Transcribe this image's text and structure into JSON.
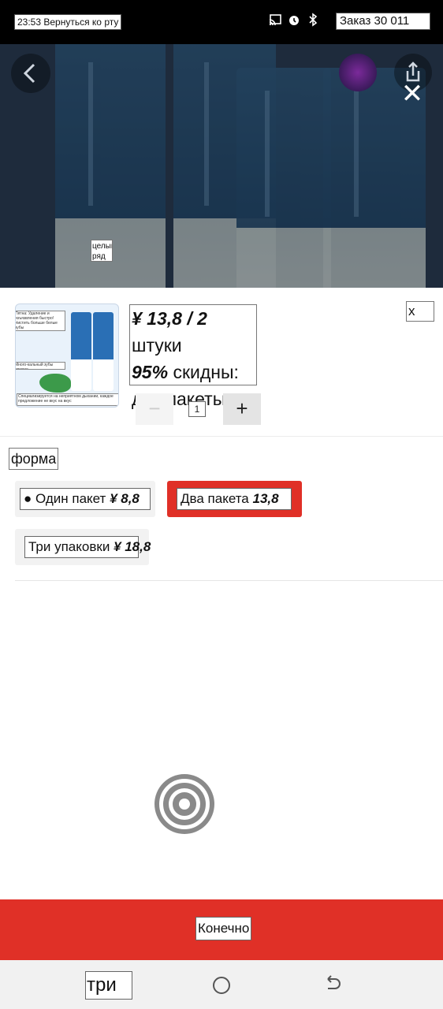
{
  "status_bar": {
    "left_text": "23:53 Вернуться ко рту",
    "right_text": "Заказ 30 011"
  },
  "hero": {
    "label": "целый ряд"
  },
  "product": {
    "price_line1": "¥ 13,8 / 2",
    "price_line1_suffix": "штуки",
    "discount": "95%",
    "discount_suffix": "скидны:",
    "price_line3": "две пакеты",
    "close_label": "x",
    "quantity": "1",
    "minus": "−",
    "plus": "+",
    "thumb_captions": [
      "Пятна: Удаление и изъязвления быстро! Чистить больше белые зубы",
      "Много-кальный зубы свежие",
      "Специализируется на неприятном дыхании, каждое предложение не вкус на вкус"
    ]
  },
  "options": {
    "section_label": "форма",
    "items": [
      {
        "prefix": "● Один пакет",
        "price": "¥ 8,8",
        "selected": false
      },
      {
        "prefix": "Два пакета",
        "price": "13,8",
        "selected": true
      },
      {
        "prefix": "Три упаковки",
        "price": "¥ 18,8",
        "selected": false
      }
    ]
  },
  "confirm": {
    "label": "Конечно"
  },
  "nav": {
    "recent_label": "три"
  },
  "colors": {
    "accent": "#e03027",
    "hero_bg": "#27374d"
  }
}
